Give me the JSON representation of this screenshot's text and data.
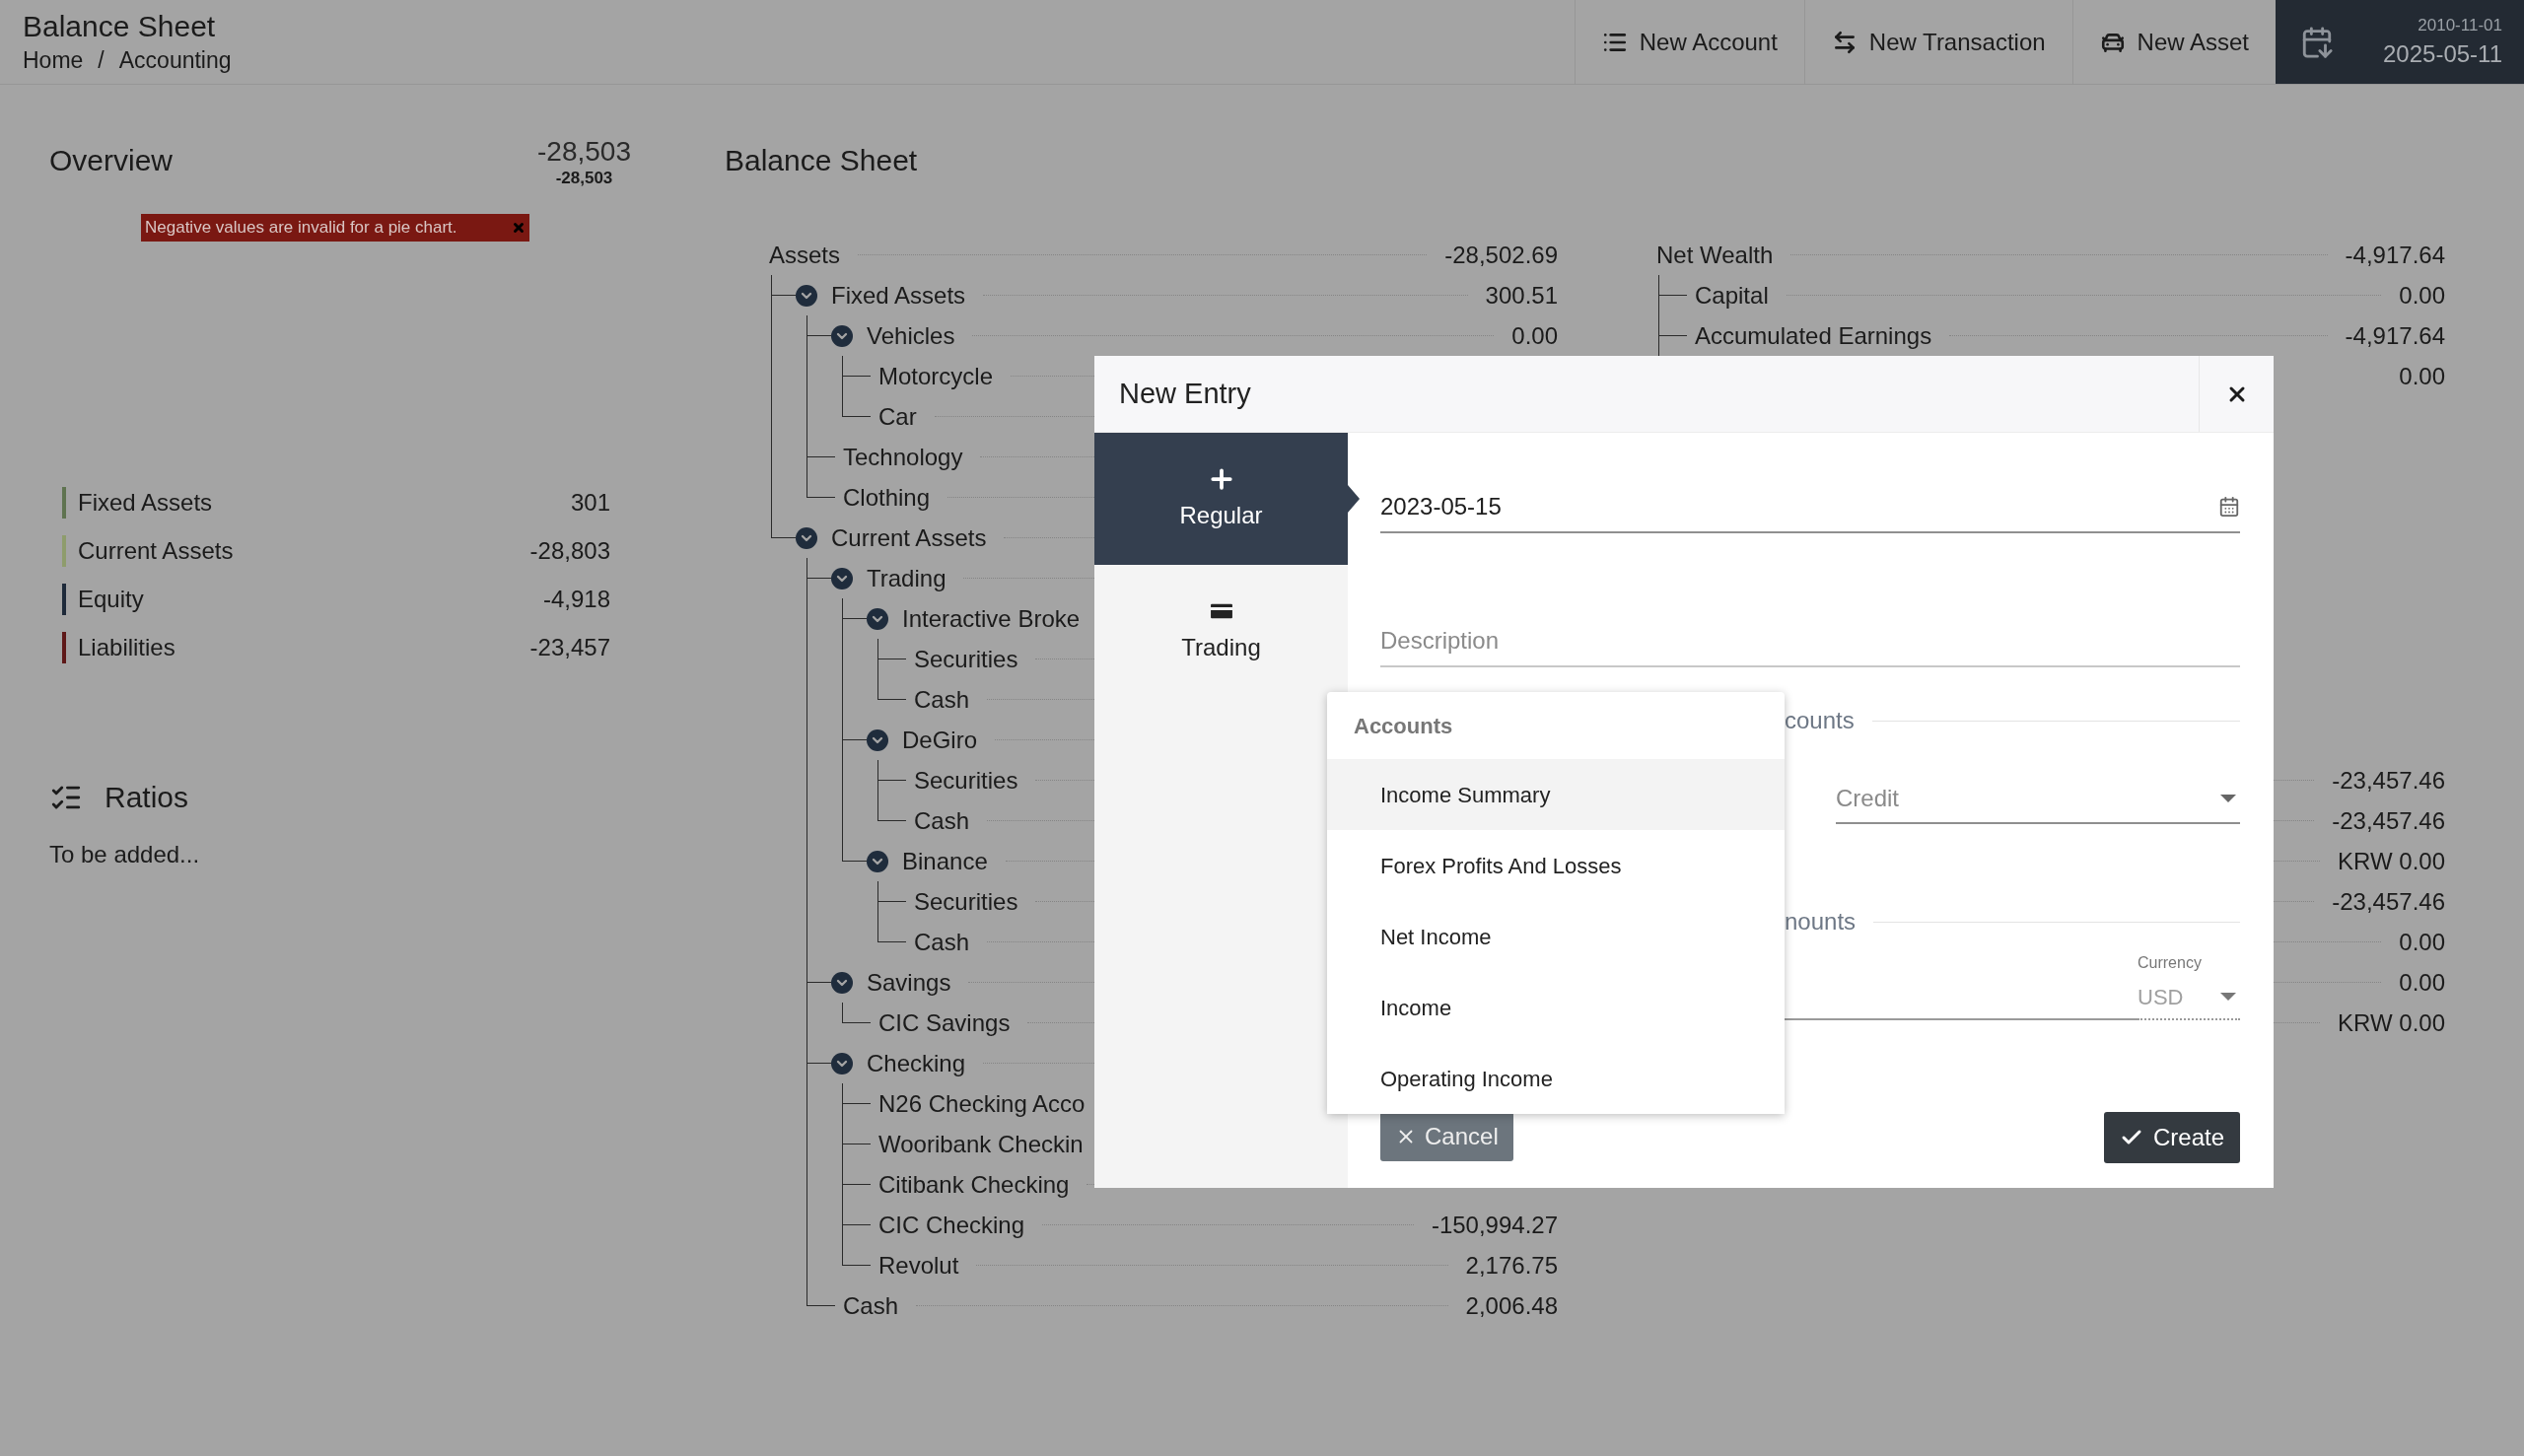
{
  "header": {
    "title": "Balance Sheet",
    "breadcrumb": [
      "Home",
      "Accounting"
    ],
    "separator": "/",
    "actions": [
      {
        "label": "New Account"
      },
      {
        "label": "New Transaction"
      },
      {
        "label": "New Asset"
      }
    ],
    "date_range": {
      "start": "2010-11-01",
      "end": "2025-05-11"
    }
  },
  "overview": {
    "title": "Overview",
    "total": "-28,503",
    "subtotal": "-28,503",
    "error": "Negative values are invalid for a pie chart.",
    "legend": [
      {
        "label": "Fixed Assets",
        "value": "301",
        "color": "#5f7350"
      },
      {
        "label": "Current Assets",
        "value": "-28,803",
        "color": "#8e9c6c"
      },
      {
        "label": "Equity",
        "value": "-4,918",
        "color": "#1e2a3a"
      },
      {
        "label": "Liabilities",
        "value": "-23,457",
        "color": "#5e1818"
      }
    ]
  },
  "ratios": {
    "title": "Ratios",
    "text": "To be added..."
  },
  "balance_sheet": {
    "title": "Balance Sheet",
    "assets": {
      "label": "Assets",
      "value": "-28,502.69",
      "children": [
        {
          "label": "Fixed Assets",
          "value": "300.51",
          "expanded": true,
          "children": [
            {
              "label": "Vehicles",
              "value": "0.00",
              "expanded": true,
              "children": [
                {
                  "label": "Motorcycle"
                },
                {
                  "label": "Car"
                }
              ]
            },
            {
              "label": "Technology"
            },
            {
              "label": "Clothing"
            }
          ]
        },
        {
          "label": "Current Assets",
          "expanded": true,
          "children": [
            {
              "label": "Trading",
              "expanded": true,
              "children": [
                {
                  "label": "Interactive Broke",
                  "expanded": true,
                  "children": [
                    {
                      "label": "Securities"
                    },
                    {
                      "label": "Cash"
                    }
                  ]
                },
                {
                  "label": "DeGiro",
                  "expanded": true,
                  "children": [
                    {
                      "label": "Securities"
                    },
                    {
                      "label": "Cash"
                    }
                  ]
                },
                {
                  "label": "Binance",
                  "expanded": true,
                  "children": [
                    {
                      "label": "Securities"
                    },
                    {
                      "label": "Cash"
                    }
                  ]
                }
              ]
            },
            {
              "label": "Savings",
              "expanded": true,
              "children": [
                {
                  "label": "CIC Savings"
                }
              ]
            },
            {
              "label": "Checking",
              "expanded": true,
              "children": [
                {
                  "label": "N26 Checking Acco"
                },
                {
                  "label": "Wooribank Checkin"
                },
                {
                  "label": "Citibank Checking"
                },
                {
                  "label": "CIC Checking",
                  "value": "-150,994.27"
                },
                {
                  "label": "Revolut",
                  "value": "2,176.75"
                }
              ]
            },
            {
              "label": "Cash",
              "value": "2,006.48"
            }
          ]
        }
      ]
    },
    "equity": {
      "label": "Net Wealth",
      "value": "-4,917.64",
      "children": [
        {
          "label": "Capital",
          "value": "0.00"
        },
        {
          "label": "Accumulated Earnings",
          "value": "-4,917.64"
        },
        {
          "value": "0.00"
        }
      ]
    },
    "lower_values": [
      "-23,457.46",
      "-23,457.46",
      "KRW 0.00",
      "-23,457.46",
      "0.00",
      "0.00",
      "KRW 0.00"
    ]
  },
  "modal": {
    "title": "New Entry",
    "tabs": [
      {
        "label": "Regular",
        "selected": true
      },
      {
        "label": "Trading",
        "selected": false
      }
    ],
    "date": "2023-05-15",
    "description_placeholder": "Description",
    "sections": [
      "counts",
      "nounts"
    ],
    "side": "Credit",
    "currency_label": "Currency",
    "currency": "USD",
    "cancel": "Cancel",
    "create": "Create",
    "menu": {
      "header": "Accounts",
      "items": [
        {
          "label": "Income Summary",
          "selected": true
        },
        {
          "label": "Forex Profits And Losses",
          "selected": false
        },
        {
          "label": "Net Income",
          "selected": false
        },
        {
          "label": "Income",
          "selected": false
        },
        {
          "label": "Operating Income",
          "selected": false
        }
      ]
    }
  }
}
